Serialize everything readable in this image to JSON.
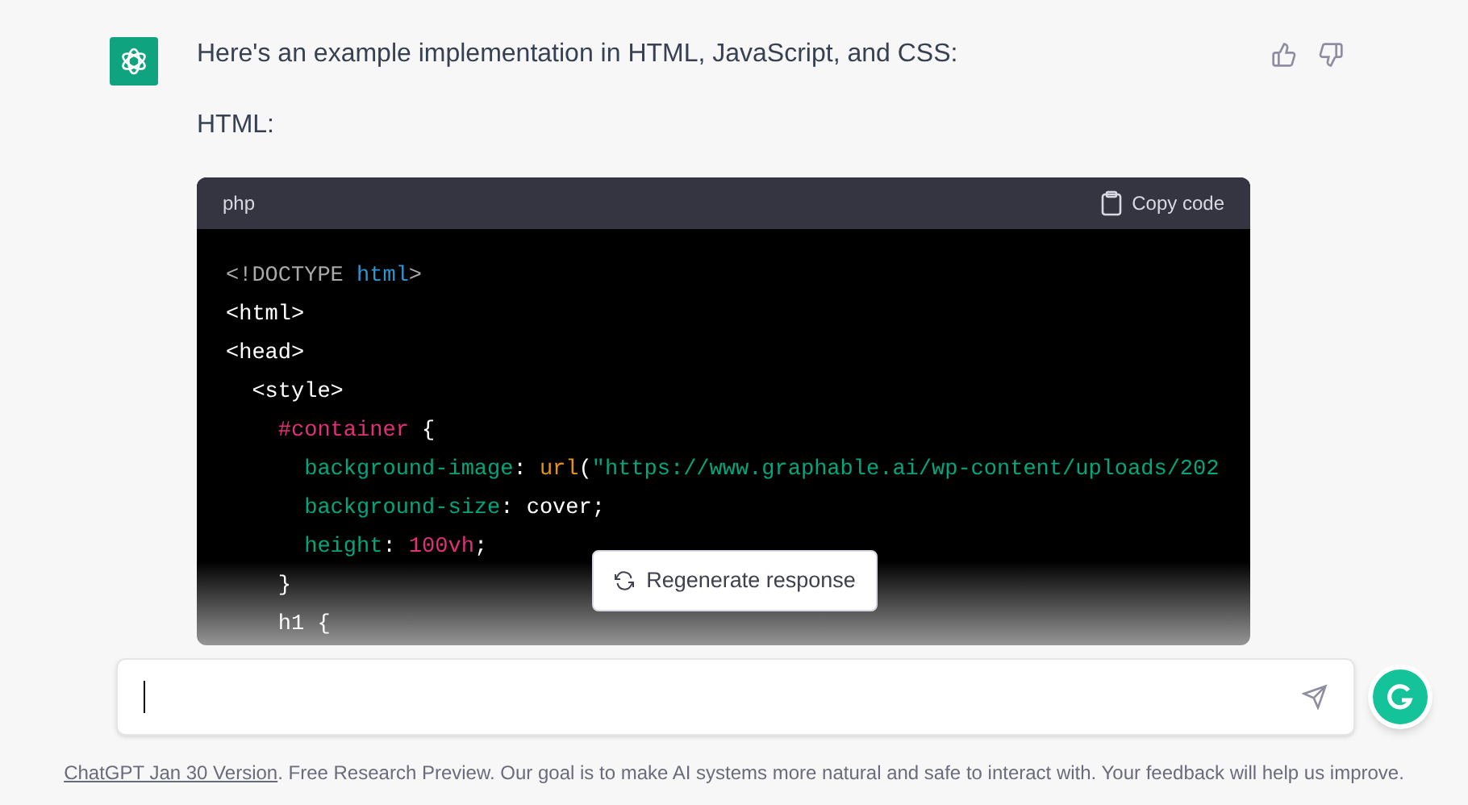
{
  "message": {
    "intro": "Here's an example implementation in HTML, JavaScript, and CSS:",
    "label": "HTML:"
  },
  "code_block": {
    "language": "php",
    "copy_label": "Copy code",
    "lines": [
      [
        {
          "text": "<!DOCTYPE ",
          "kind": "meta"
        },
        {
          "text": "html",
          "kind": "keyword"
        },
        {
          "text": ">",
          "kind": "meta"
        }
      ],
      [
        {
          "text": "<html>",
          "kind": "tag"
        }
      ],
      [
        {
          "text": "<head>",
          "kind": "tag"
        }
      ],
      [
        {
          "text": "  <style>",
          "kind": "tag"
        }
      ],
      [
        {
          "text": "    #container",
          "kind": "selector"
        },
        {
          "text": " {",
          "kind": "plain"
        }
      ],
      [
        {
          "text": "      background-image",
          "kind": "property"
        },
        {
          "text": ": ",
          "kind": "plain"
        },
        {
          "text": "url",
          "kind": "function"
        },
        {
          "text": "(",
          "kind": "plain"
        },
        {
          "text": "\"https://www.graphable.ai/wp-content/uploads/202",
          "kind": "string"
        }
      ],
      [
        {
          "text": "      background-size",
          "kind": "property"
        },
        {
          "text": ": cover;",
          "kind": "plain"
        }
      ],
      [
        {
          "text": "      height",
          "kind": "property"
        },
        {
          "text": ": ",
          "kind": "plain"
        },
        {
          "text": "100vh",
          "kind": "number"
        },
        {
          "text": ";",
          "kind": "plain"
        }
      ],
      [
        {
          "text": "    }",
          "kind": "plain"
        }
      ],
      [
        {
          "text": "    h1 {",
          "kind": "plain"
        }
      ]
    ]
  },
  "regenerate_button": {
    "label": "Regenerate response"
  },
  "footer": {
    "link": "ChatGPT Jan 30 Version",
    "text": ". Free Research Preview. Our goal is to make AI systems more natural and safe to interact with. Your feedback will help us improve."
  }
}
